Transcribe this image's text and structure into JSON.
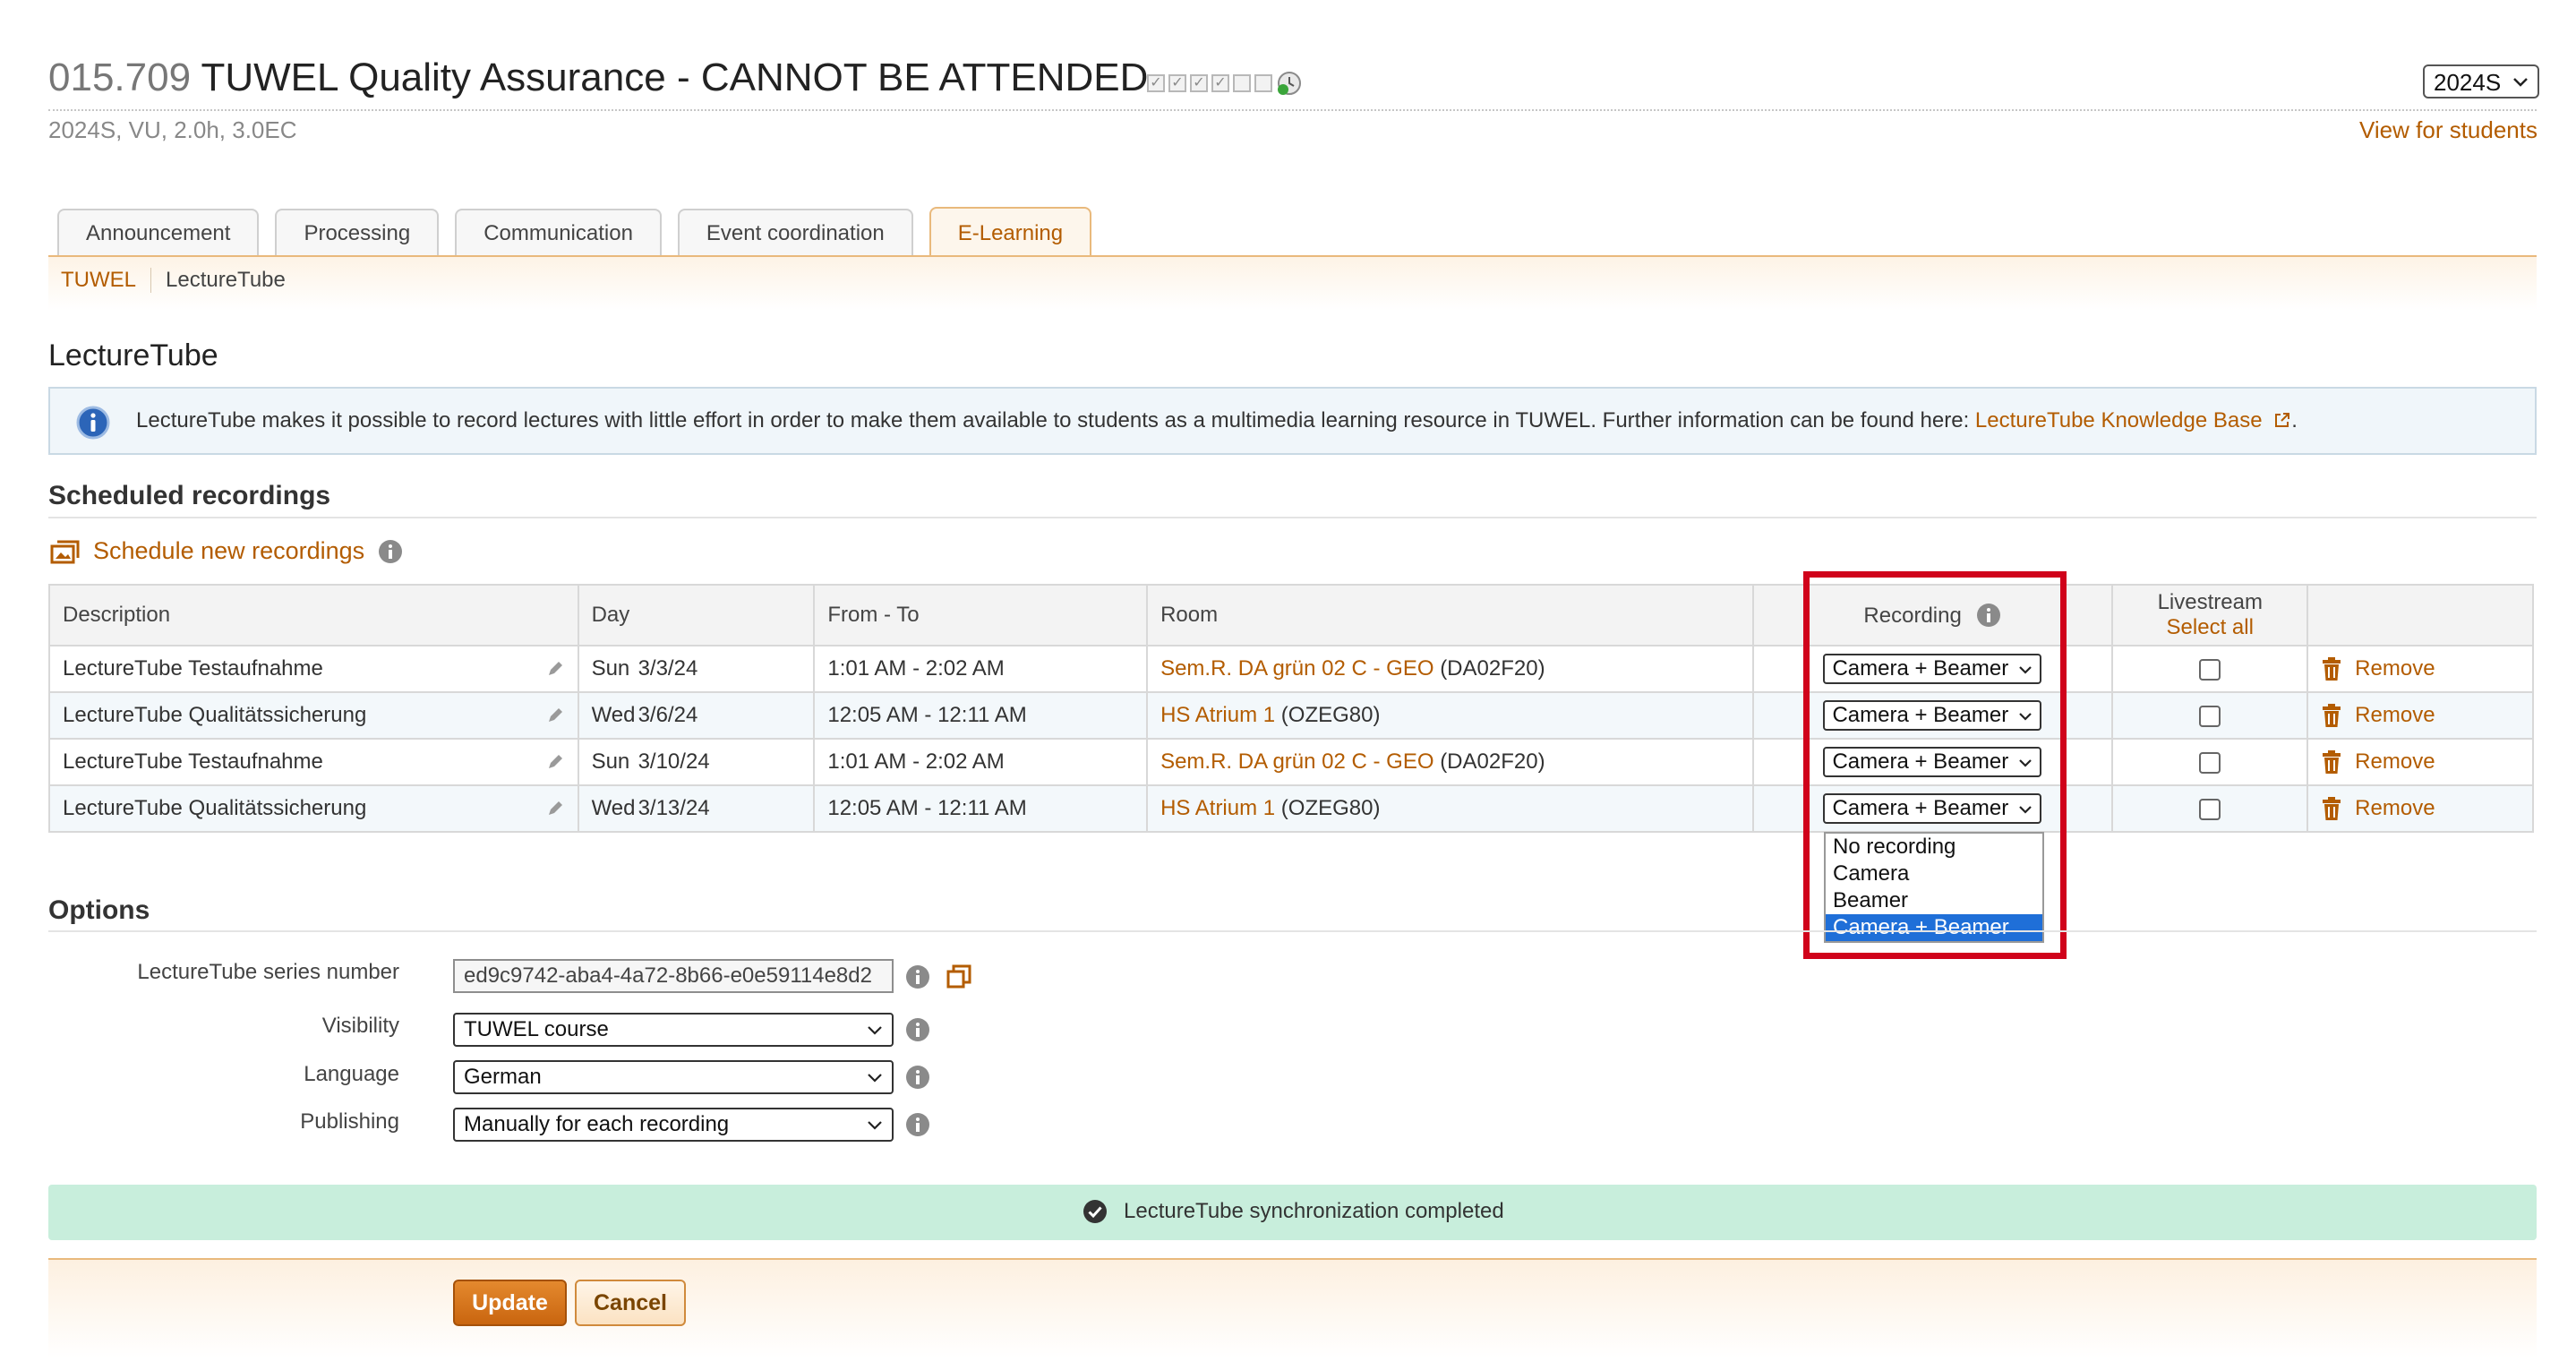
{
  "header": {
    "course_number": "015.709",
    "course_title": "TUWEL Quality Assurance - CANNOT BE ATTENDED",
    "subtitle": "2024S, VU, 2.0h, 3.0EC",
    "semester_select": "2024S",
    "view_for_students": "View for students"
  },
  "tabs": [
    {
      "label": "Announcement",
      "active": false
    },
    {
      "label": "Processing",
      "active": false
    },
    {
      "label": "Communication",
      "active": false
    },
    {
      "label": "Event coordination",
      "active": false
    },
    {
      "label": "E-Learning",
      "active": true
    }
  ],
  "subnav": {
    "tuwel": "TUWEL",
    "lecturetube": "LectureTube"
  },
  "page_heading": "LectureTube",
  "info": {
    "text": "LectureTube makes it possible to record lectures with little effort in order to make them available to students as a multimedia learning resource in TUWEL. Further information can be found here: ",
    "link": "LectureTube Knowledge Base",
    "suffix": "."
  },
  "scheduled": {
    "heading": "Scheduled recordings",
    "schedule_new": "Schedule new recordings",
    "columns": {
      "description": "Description",
      "day": "Day",
      "from_to": "From - To",
      "room": "Room",
      "recording": "Recording",
      "livestream": "Livestream",
      "select_all": "Select all"
    },
    "rows": [
      {
        "description": "LectureTube Testaufnahme",
        "weekday": "Sun",
        "date": "3/3/24",
        "time": "1:01 AM - 2:02 AM",
        "room_link": "Sem.R. DA grün 02 C - GEO",
        "room_code": "(DA02F20)",
        "recording": "Camera + Beamer",
        "livestream": false,
        "remove": "Remove"
      },
      {
        "description": "LectureTube Qualitätssicherung",
        "weekday": "Wed",
        "date": "3/6/24",
        "time": "12:05 AM - 12:11 AM",
        "room_link": "HS Atrium 1",
        "room_code": "(OZEG80)",
        "recording": "Camera + Beamer",
        "livestream": false,
        "remove": "Remove"
      },
      {
        "description": "LectureTube Testaufnahme",
        "weekday": "Sun",
        "date": "3/10/24",
        "time": "1:01 AM - 2:02 AM",
        "room_link": "Sem.R. DA grün 02 C - GEO",
        "room_code": "(DA02F20)",
        "recording": "Camera + Beamer",
        "livestream": false,
        "remove": "Remove"
      },
      {
        "description": "LectureTube Qualitätssicherung",
        "weekday": "Wed",
        "date": "3/13/24",
        "time": "12:05 AM - 12:11 AM",
        "room_link": "HS Atrium 1",
        "room_code": "(OZEG80)",
        "recording": "Camera + Beamer",
        "livestream": false,
        "remove": "Remove"
      }
    ],
    "dropdown_options": [
      "No recording",
      "Camera",
      "Beamer",
      "Camera + Beamer"
    ],
    "dropdown_selected": "Camera + Beamer"
  },
  "options": {
    "heading": "Options",
    "series_label": "LectureTube series number",
    "series_value": "ed9c9742-aba4-4a72-8b66-e0e59114e8d2",
    "visibility_label": "Visibility",
    "visibility_value": "TUWEL course",
    "language_label": "Language",
    "language_value": "German",
    "publishing_label": "Publishing",
    "publishing_value": "Manually for each recording"
  },
  "sync_message": "LectureTube synchronization completed",
  "buttons": {
    "update": "Update",
    "cancel": "Cancel"
  },
  "colors": {
    "accent": "#b35c00",
    "highlight": "#d0021b",
    "success_bg": "#c8eedc",
    "selected_option": "#1f6fd8"
  }
}
